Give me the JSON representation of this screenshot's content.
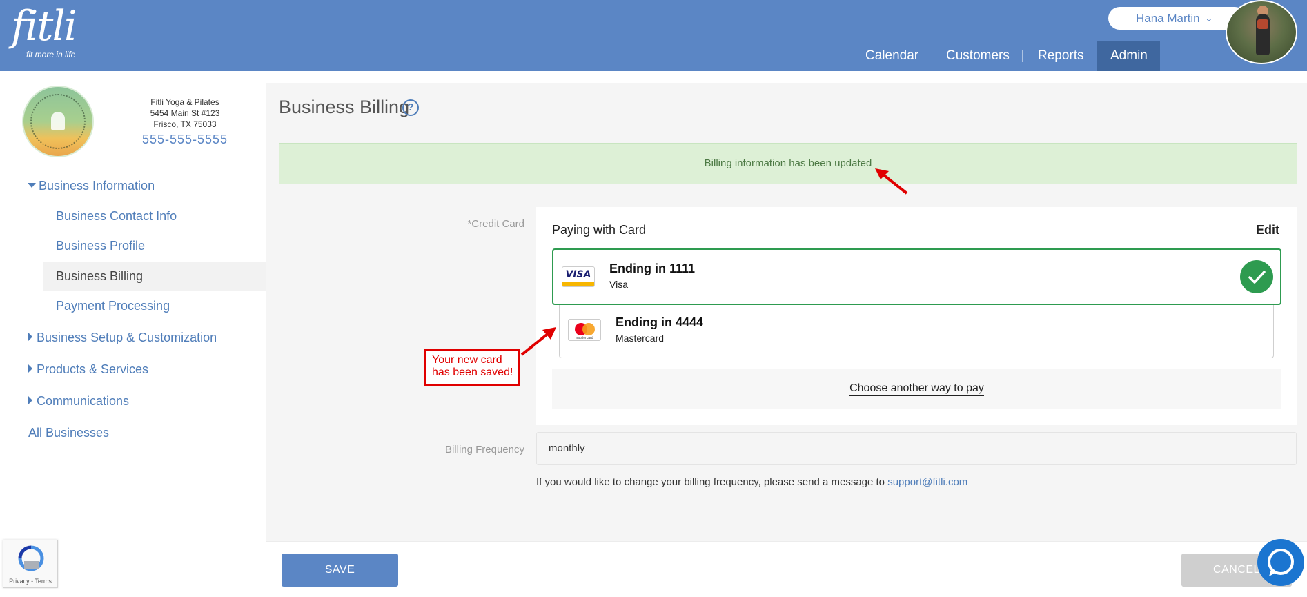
{
  "header": {
    "logo_text": "fitli",
    "logo_tagline": "fit more in life",
    "user_name": "Hana Martin",
    "user_chevron": "⌄",
    "nav": [
      {
        "label": "Calendar"
      },
      {
        "label": "Customers"
      },
      {
        "label": "Reports"
      },
      {
        "label": "Admin",
        "active": true
      }
    ]
  },
  "business": {
    "logo_text": "FITLI YOGA & PILATES",
    "name": "Fitli Yoga & Pilates",
    "address1": "5454 Main St #123",
    "address2": "Frisco, TX 75033",
    "phone": "555-555-5555"
  },
  "sidebar": {
    "items": [
      {
        "label": "Business Information",
        "expanded": true
      },
      {
        "label": "Business Contact Info"
      },
      {
        "label": "Business Profile"
      },
      {
        "label": "Business Billing",
        "active": true
      },
      {
        "label": "Payment Processing"
      },
      {
        "label": "Business Setup & Customization",
        "expanded": false
      },
      {
        "label": "Products & Services",
        "expanded": false
      },
      {
        "label": "Communications",
        "expanded": false
      },
      {
        "label": "All Businesses"
      }
    ]
  },
  "main": {
    "title": "Business Billing",
    "help_icon": "?",
    "alert": "Billing information has been updated",
    "credit_card_label": "*Credit Card",
    "paying_with_card": "Paying with Card",
    "edit_label": "Edit",
    "cards": [
      {
        "brand_icon": "visa-icon",
        "brand_text": "VISA",
        "title": "Ending in 1111",
        "brand": "Visa",
        "selected": true
      },
      {
        "brand_icon": "mastercard-icon",
        "brand_text": "mastercard",
        "title": "Ending in 4444",
        "brand": "Mastercard",
        "selected": false
      }
    ],
    "choose_another": "Choose another way to pay",
    "callout": {
      "line1": "Your new card",
      "line2": "has been saved!"
    },
    "billing_frequency_label": "Billing Frequency",
    "billing_frequency_value": "monthly",
    "billing_note_prefix": "If you would like to change your billing frequency, please send a message to ",
    "billing_note_email": "support@fitli.com"
  },
  "footer": {
    "save_label": "SAVE",
    "cancel_label": "CANCEL"
  },
  "recaptcha": {
    "links": "Privacy - Terms"
  },
  "colors": {
    "header_blue": "#5b86c5",
    "link_blue": "#4f7db9",
    "success_green": "#2e9b50",
    "alert_bg": "#ddf0d6",
    "callout_red": "#e00000"
  }
}
